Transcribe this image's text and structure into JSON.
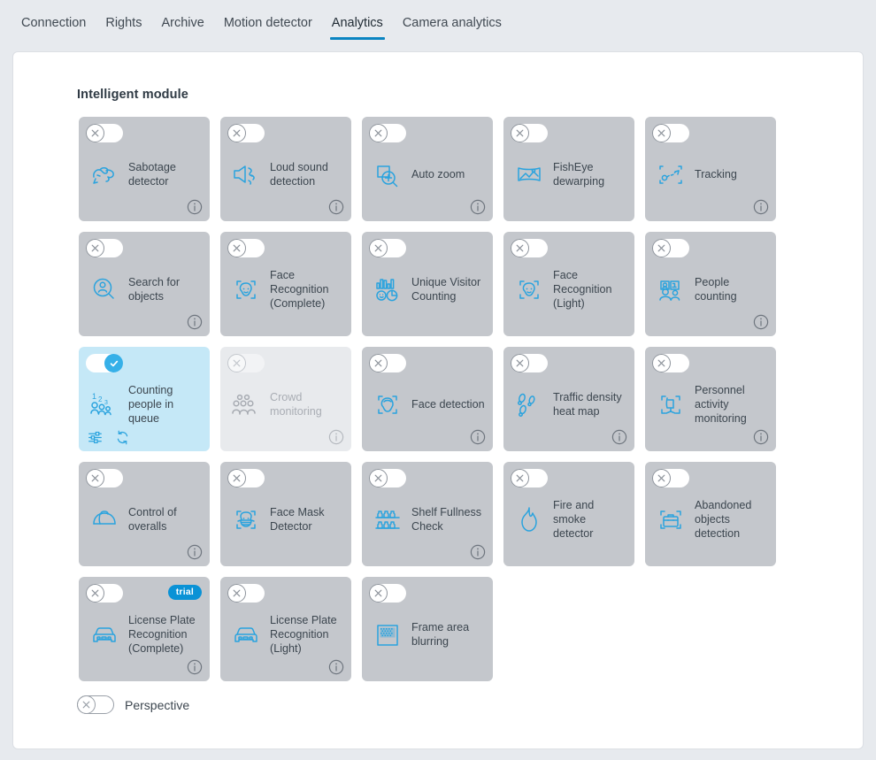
{
  "tabs": [
    {
      "label": "Connection",
      "active": false
    },
    {
      "label": "Rights",
      "active": false
    },
    {
      "label": "Archive",
      "active": false
    },
    {
      "label": "Motion detector",
      "active": false
    },
    {
      "label": "Analytics",
      "active": true
    },
    {
      "label": "Camera analytics",
      "active": false
    }
  ],
  "section": {
    "title": "Intelligent module"
  },
  "colors": {
    "accent": "#0a84c1",
    "icon_blue": "#2aa3de",
    "toggle_on": "#36b0e8",
    "card_bg": "#c4c7cc",
    "card_bg_enabled": "#c5e8f7",
    "card_bg_disabled": "#e8eaed",
    "trial_badge": "#0a92d6",
    "page_bg": "#e7eaee"
  },
  "modules": [
    {
      "label": "Sabotage detector",
      "icon": "sabotage-icon",
      "state": "off",
      "info": true,
      "trial": false
    },
    {
      "label": "Loud sound detection",
      "icon": "loud-sound-icon",
      "state": "off",
      "info": true,
      "trial": false
    },
    {
      "label": "Auto zoom",
      "icon": "auto-zoom-icon",
      "state": "off",
      "info": true,
      "trial": false
    },
    {
      "label": "FishEye dewarping",
      "icon": "fisheye-icon",
      "state": "off",
      "info": false,
      "trial": false
    },
    {
      "label": "Tracking",
      "icon": "tracking-icon",
      "state": "off",
      "info": true,
      "trial": false
    },
    {
      "label": "Search for objects",
      "icon": "search-person-icon",
      "state": "off",
      "info": true,
      "trial": false
    },
    {
      "label": "Face Recognition (Complete)",
      "icon": "face-recognition-icon",
      "state": "off",
      "info": false,
      "trial": false
    },
    {
      "label": "Unique Visitor Counting",
      "icon": "unique-visitor-icon",
      "state": "off",
      "info": false,
      "trial": false
    },
    {
      "label": "Face Recognition (Light)",
      "icon": "face-recognition-icon",
      "state": "off",
      "info": false,
      "trial": false
    },
    {
      "label": "People counting",
      "icon": "people-counting-icon",
      "state": "off",
      "info": true,
      "trial": false
    },
    {
      "label": "Counting people in queue",
      "icon": "counting-queue-icon",
      "state": "on",
      "info": false,
      "trial": false,
      "actions": [
        "settings-sliders-icon",
        "refresh-icon"
      ]
    },
    {
      "label": "Crowd monitoring",
      "icon": "crowd-icon",
      "state": "disabled",
      "info": true,
      "trial": false
    },
    {
      "label": "Face detection",
      "icon": "face-detection-icon",
      "state": "off",
      "info": true,
      "trial": false
    },
    {
      "label": "Traffic density heat map",
      "icon": "footsteps-icon",
      "state": "off",
      "info": true,
      "trial": false
    },
    {
      "label": "Personnel activity monitoring",
      "icon": "chair-monitor-icon",
      "state": "off",
      "info": true,
      "trial": false
    },
    {
      "label": "Control of overalls",
      "icon": "hardhat-icon",
      "state": "off",
      "info": true,
      "trial": false
    },
    {
      "label": "Face Mask Detector",
      "icon": "face-mask-icon",
      "state": "off",
      "info": false,
      "trial": false
    },
    {
      "label": "Shelf Fullness Check",
      "icon": "shelf-icon",
      "state": "off",
      "info": true,
      "trial": false
    },
    {
      "label": "Fire and smoke detector",
      "icon": "flame-icon",
      "state": "off",
      "info": false,
      "trial": false
    },
    {
      "label": "Abandoned objects detection",
      "icon": "abandoned-bag-icon",
      "state": "off",
      "info": false,
      "trial": false
    },
    {
      "label": "License Plate Recognition (Complete)",
      "icon": "car-plate-icon",
      "state": "off",
      "info": true,
      "trial": true,
      "trial_label": "trial"
    },
    {
      "label": "License Plate Recognition (Light)",
      "icon": "car-plate-icon",
      "state": "off",
      "info": true,
      "trial": false
    },
    {
      "label": "Frame area blurring",
      "icon": "blur-area-icon",
      "state": "off",
      "info": false,
      "trial": false
    }
  ],
  "perspective": {
    "label": "Perspective",
    "state": "off"
  }
}
